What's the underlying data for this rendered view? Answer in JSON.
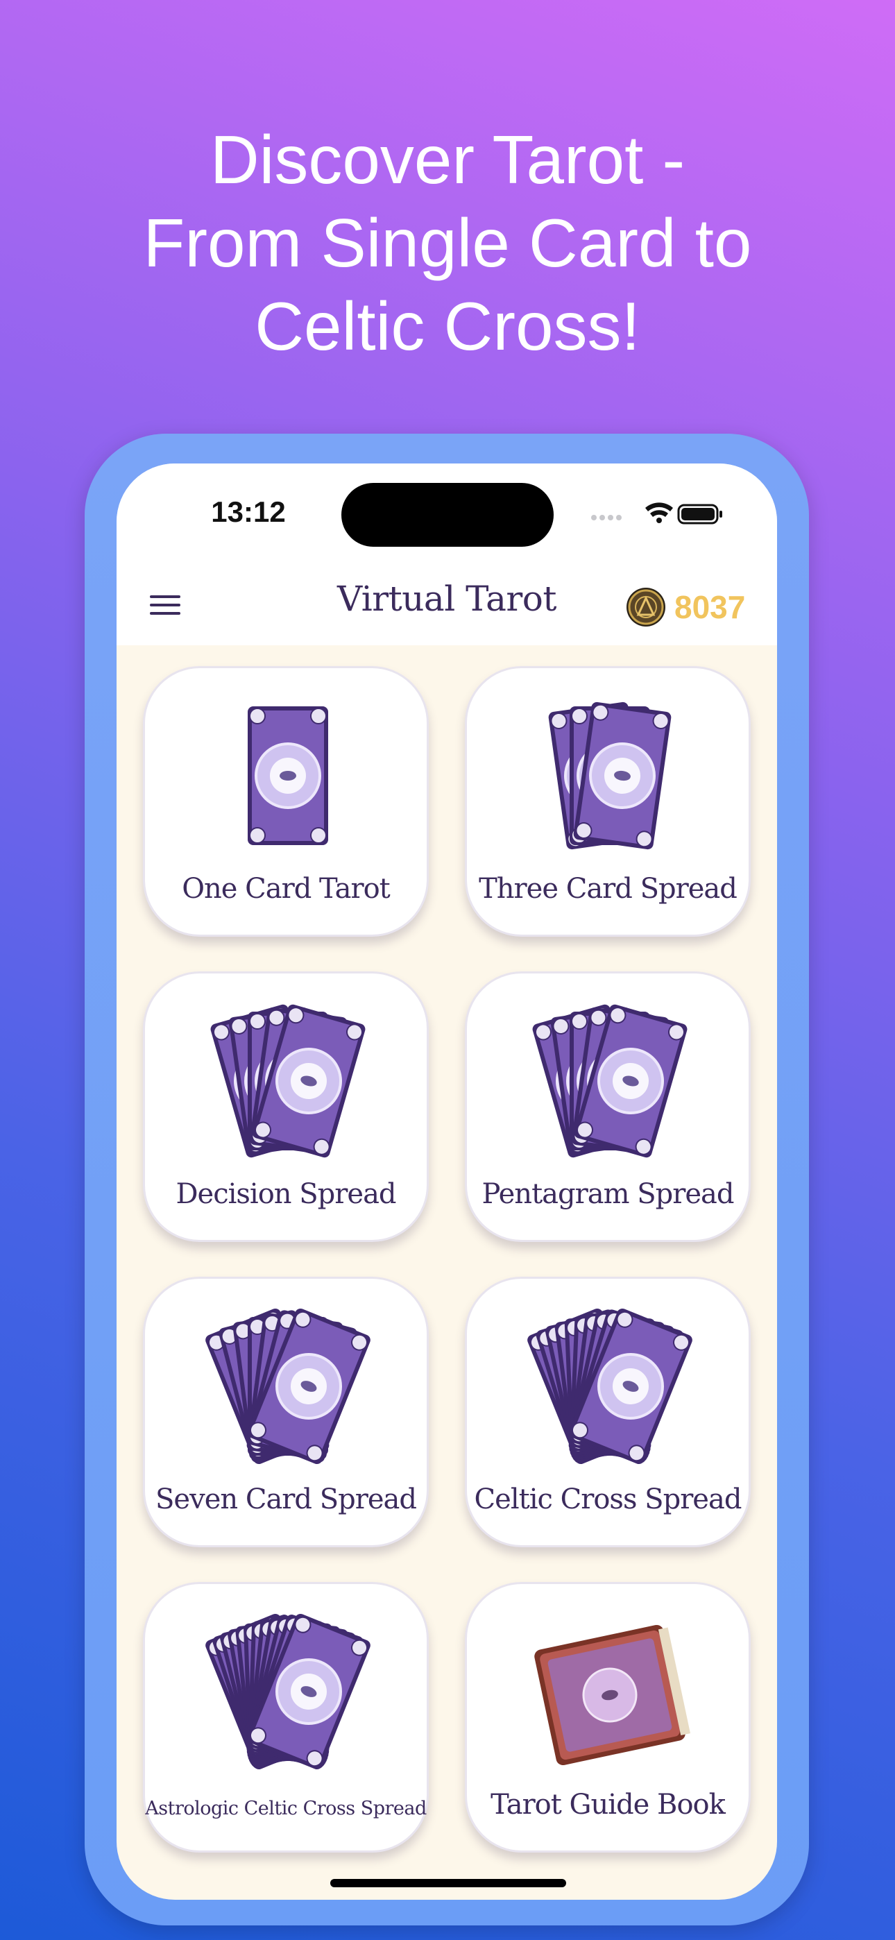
{
  "headline": "Discover Tarot -\nFrom Single Card to\nCeltic Cross!",
  "status": {
    "time": "13:12"
  },
  "app": {
    "title": "Virtual Tarot",
    "coins": "8037"
  },
  "tiles": [
    {
      "label": "One Card Tarot",
      "cards": 1
    },
    {
      "label": "Three Card Spread",
      "cards": 3
    },
    {
      "label": "Decision Spread",
      "cards": 5
    },
    {
      "label": "Pentagram Spread",
      "cards": 5
    },
    {
      "label": "Seven Card Spread",
      "cards": 7
    },
    {
      "label": "Celtic Cross Spread",
      "cards": 10
    },
    {
      "label": "Astrologic Celtic Cross Spread",
      "cards": 12
    },
    {
      "label": "Tarot Guide Book",
      "cards": 0
    }
  ],
  "colors": {
    "title": "#3b2b5c",
    "coin": "#f1c45d",
    "card_back": "#7b5cb8",
    "card_border": "#3f2a6e"
  }
}
